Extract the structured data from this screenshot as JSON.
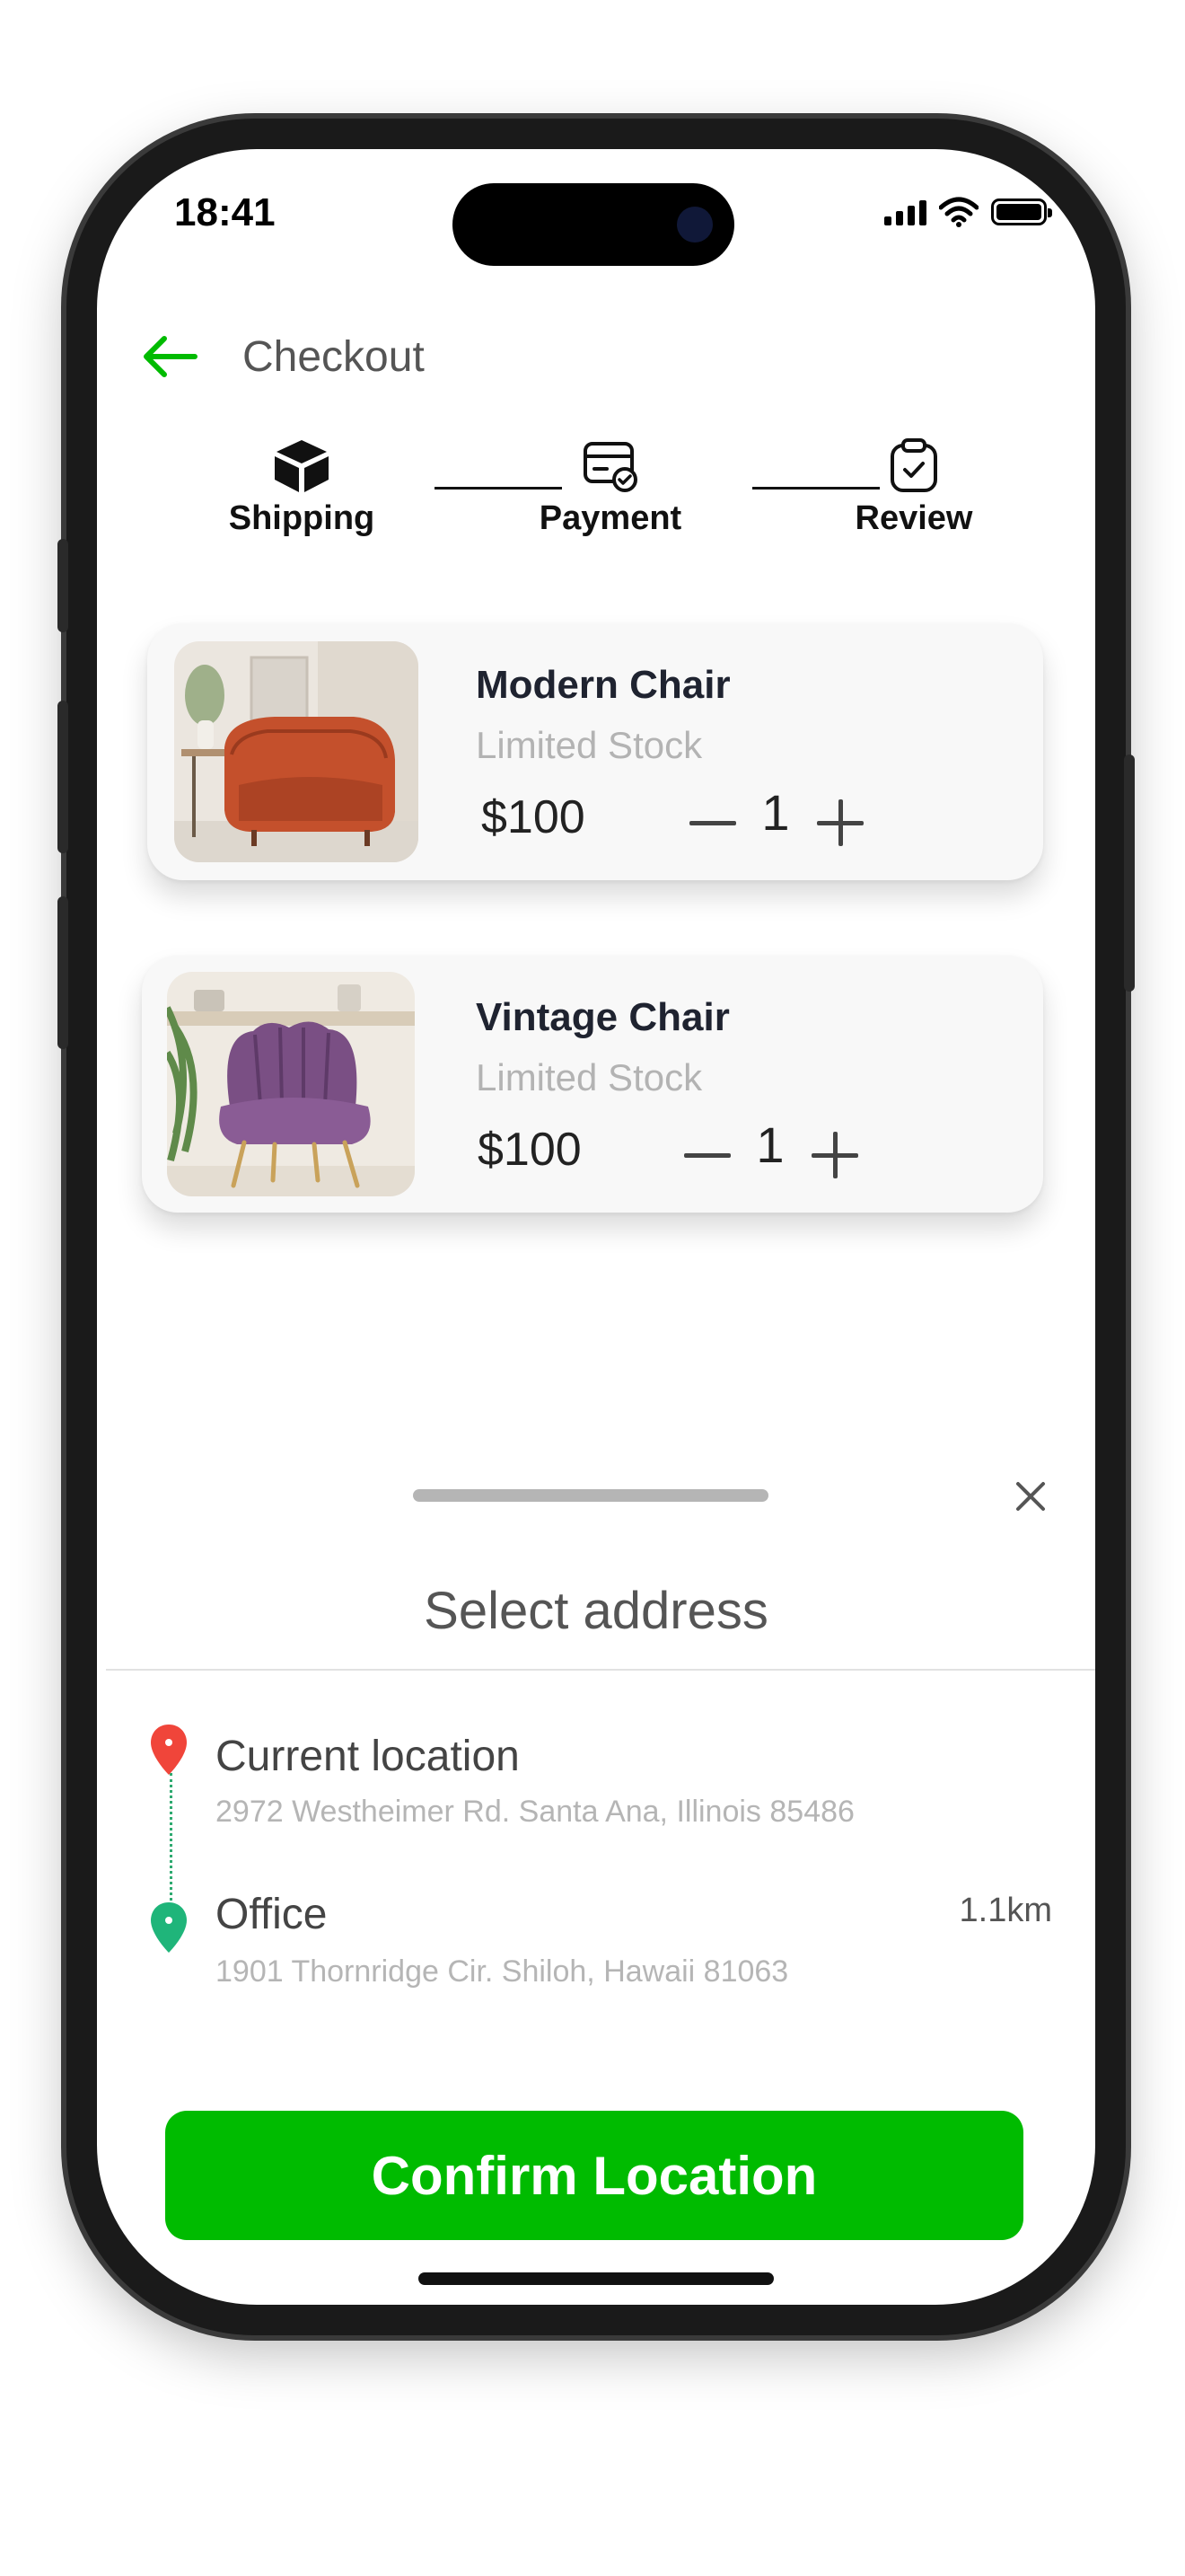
{
  "status_bar": {
    "time": "18:41"
  },
  "header": {
    "title": "Checkout"
  },
  "steps": [
    {
      "label": "Shipping"
    },
    {
      "label": "Payment"
    },
    {
      "label": "Review"
    }
  ],
  "cart": [
    {
      "name": "Modern Chair",
      "stock": "Limited Stock",
      "price": "$100",
      "quantity": "1"
    },
    {
      "name": "Vintage Chair",
      "stock": "Limited Stock",
      "price": "$100",
      "quantity": "1"
    }
  ],
  "sheet": {
    "title": "Select address",
    "locations": [
      {
        "name": "Current location",
        "address": "2972 Westheimer Rd. Santa Ana, Illinois 85486",
        "pin_color": "#f0453a"
      },
      {
        "name": "Office",
        "address": "1901 Thornridge Cir. Shiloh, Hawaii 81063",
        "distance": "1.1km",
        "pin_color": "#1fb57a"
      }
    ],
    "confirm_label": "Confirm Location"
  },
  "colors": {
    "accent": "#00bb00",
    "text_muted": "#b3b3b3"
  }
}
